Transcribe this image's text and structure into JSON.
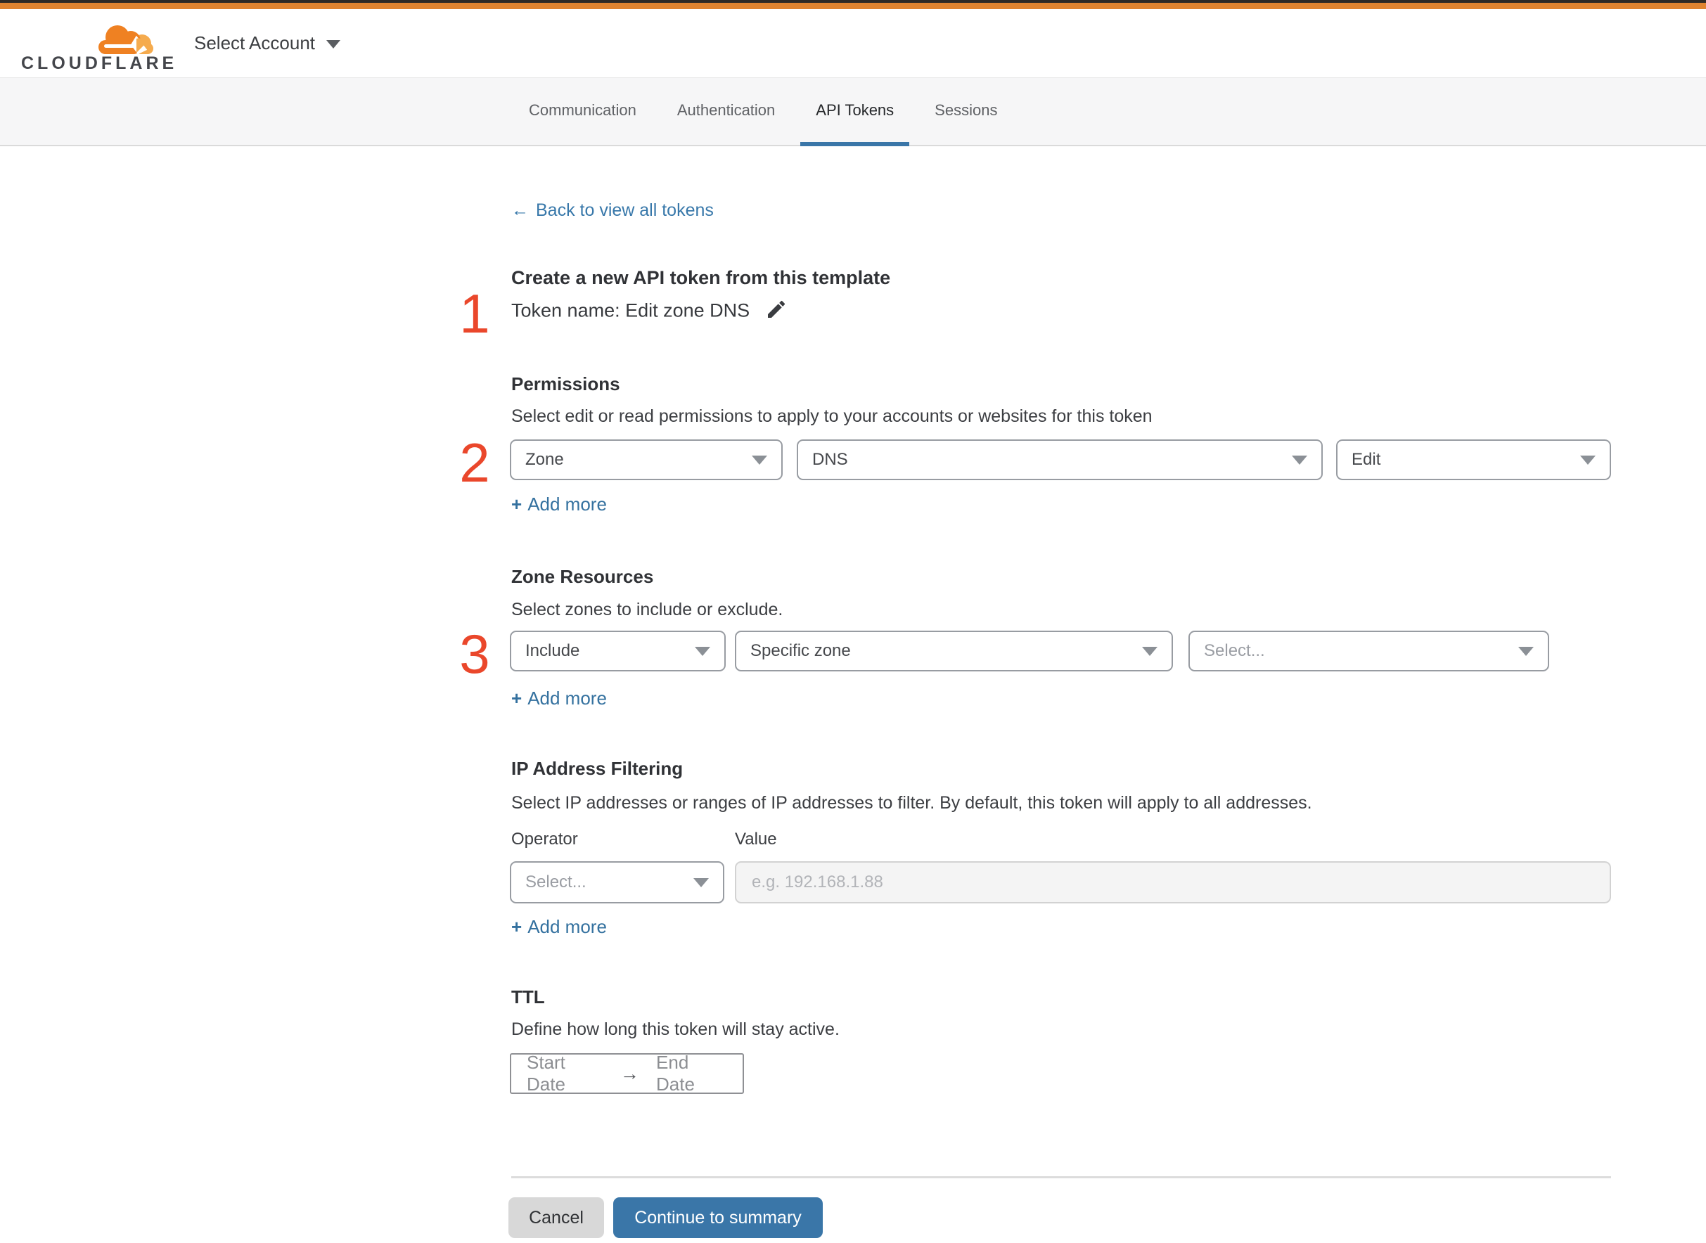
{
  "header": {
    "logo_text": "CLOUDFLARE",
    "account_selector": "Select Account"
  },
  "tabs": {
    "items": [
      {
        "label": "Communication",
        "active": false
      },
      {
        "label": "Authentication",
        "active": false
      },
      {
        "label": "API Tokens",
        "active": true
      },
      {
        "label": "Sessions",
        "active": false
      }
    ]
  },
  "back_link": {
    "label": "Back to view all tokens"
  },
  "icons": {
    "back_arrow": "←",
    "plus": "+",
    "range_arrow": "→"
  },
  "token_section": {
    "step_number": "1",
    "title": "Create a new API token from this template",
    "token_name_line": "Token name: Edit zone DNS"
  },
  "permissions": {
    "step_number": "2",
    "title": "Permissions",
    "description": "Select edit or read permissions to apply to your accounts or websites for this token",
    "dropdowns": [
      {
        "value": "Zone"
      },
      {
        "value": "DNS"
      },
      {
        "value": "Edit"
      }
    ],
    "add_more_label": "Add more"
  },
  "zone_resources": {
    "step_number": "3",
    "title": "Zone Resources",
    "description": "Select zones to include or exclude.",
    "dropdowns": [
      {
        "value": "Include"
      },
      {
        "value": "Specific zone"
      },
      {
        "value": "Select..."
      }
    ],
    "add_more_label": "Add more"
  },
  "ip_filtering": {
    "title": "IP Address Filtering",
    "description": "Select IP addresses or ranges of IP addresses to filter. By default, this token will apply to all addresses.",
    "operator_label": "Operator",
    "value_label": "Value",
    "operator_dropdown_value": "Select...",
    "value_placeholder": "e.g. 192.168.1.88",
    "add_more_label": "Add more"
  },
  "ttl": {
    "title": "TTL",
    "description": "Define how long this token will stay active.",
    "start_label": "Start Date",
    "end_label": "End Date"
  },
  "footer": {
    "cancel_label": "Cancel",
    "continue_label": "Continue to summary"
  },
  "colors": {
    "brand_orange": "#df8431",
    "accent_blue": "#3a76a8",
    "link_blue": "#3878aa",
    "step_number_red": "#ea472b"
  }
}
